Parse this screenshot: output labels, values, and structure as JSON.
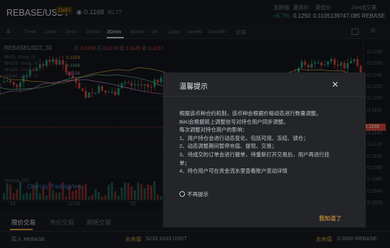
{
  "header": {
    "pair": "REBASE/USDT",
    "tag": "DeFi",
    "price": "◉ 0.1168",
    "price_change": "¥0.77",
    "stats": [
      {
        "label": "涨跌幅",
        "value": "+5.7%",
        "color": "#26a17b"
      },
      {
        "label": "最高价",
        "value": "0.1250",
        "color": "#c7cbd3"
      },
      {
        "label": "最低价",
        "value": "0.1105",
        "color": "#c7cbd3"
      },
      {
        "label": "24H成交量",
        "value": "139747.085 REBASE",
        "color": "#c7cbd3"
      }
    ]
  },
  "intervals": {
    "items": [
      "Time",
      "1min",
      "5min",
      "15min",
      "30min",
      "60min",
      "4h",
      "1day",
      "1week",
      "1month",
      "全屏"
    ],
    "active": "30min",
    "first": "Ⅲ"
  },
  "chart": {
    "symbol_line": "REBASEUSDT, 30",
    "ohlc": {
      "o_label": "开",
      "o": "0.1168",
      "h_label": "高",
      "h": "0.1178",
      "l_label": "低",
      "l": "0.1145",
      "c_label": "收",
      "c": "0.1157"
    },
    "ma_lines": [
      "MA(5, close, 0)",
      "MA(10, close, 0)",
      "MA(30, close, 0)",
      "MA(60, close, 0)"
    ],
    "ma_values": [
      "0.1159",
      "0.1168",
      "0.1126"
    ],
    "y_ticks": [
      "0.1280",
      "0.1260",
      "0.1240",
      "0.1220",
      "0.1200",
      "0.1180",
      "0.1168",
      "0.1140",
      "0.1120",
      "0.1100",
      "0.1080",
      "0.1060",
      "0.1040",
      "0.1020"
    ],
    "current_price_tag": "0.1168",
    "x_ticks": [
      "24",
      "12:00",
      "25"
    ],
    "volume_label": "Volume (20)",
    "watermark": "Chart by TradingView",
    "colors": {
      "up": "#26a17b",
      "down": "#e2473f",
      "price_tag": "#e2473f"
    }
  },
  "bottom": {
    "tabs": [
      "限价交易",
      "市价交易",
      "网格交易"
    ],
    "active_tab": "限价交易",
    "buy_label": "买入 REBASE",
    "deposit_link": "去充值",
    "balance": "5233.1633 USDT",
    "sell_deposit": "去充值",
    "sell_balance": "0.0000 REBASE"
  },
  "modal": {
    "title": "温馨提示",
    "lines": [
      "根据该币种合约机制，该币种会根据价格动态进行数量调整。",
      "BiKi会根据链上调整信号对持仓用户同步调整。",
      "每次调整对持仓用户的影响：",
      "1、用户持仓会进行动态变化，包括可用、冻结、锁仓；",
      "2、动态调整期间暂停充值、提现、交易；",
      "3、待成交的订单会进行撤单，待重新打开交易后，用户再进行挂",
      "单；",
      "4、持仓用户可在资金流水里查看账户变动详情"
    ],
    "checkbox_label": "不再提示",
    "confirm": "我知道了"
  }
}
